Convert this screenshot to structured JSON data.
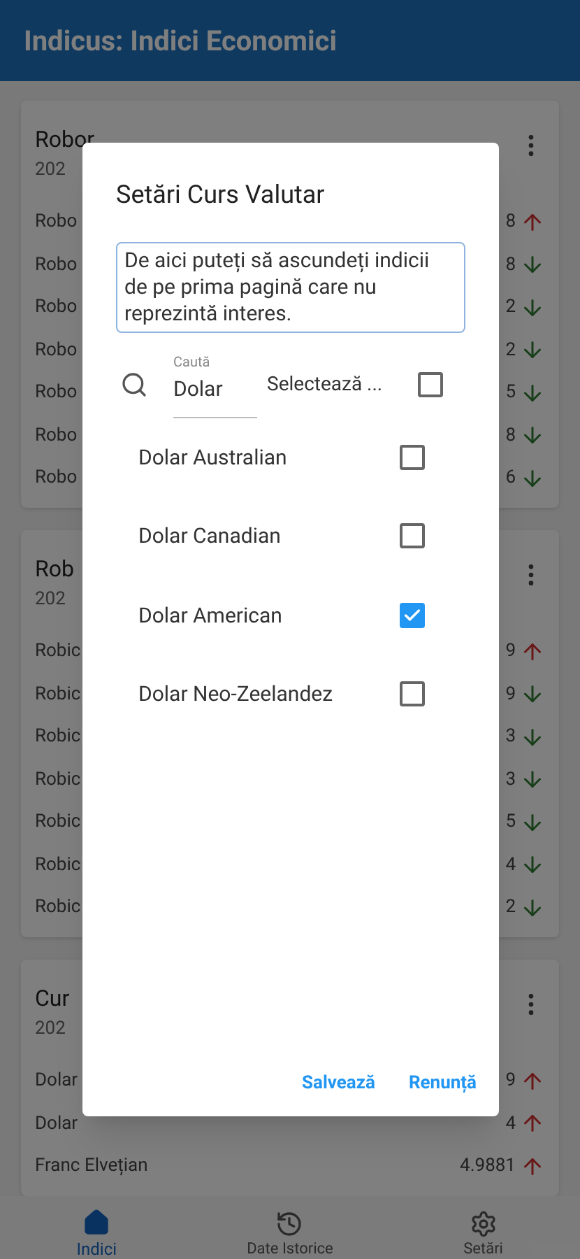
{
  "app_bar": {
    "title": "Indicus: Indici Economici"
  },
  "cards": [
    {
      "title": "Robor",
      "date": "202",
      "rows": [
        {
          "label": "Robo",
          "value": "8",
          "kind": "up"
        },
        {
          "label": "Robo",
          "value": "8",
          "kind": "down"
        },
        {
          "label": "Robo",
          "value": "2",
          "kind": "down"
        },
        {
          "label": "Robo",
          "value": "2",
          "kind": "down"
        },
        {
          "label": "Robo",
          "value": "5",
          "kind": "down"
        },
        {
          "label": "Robo",
          "value": "8",
          "kind": "down"
        },
        {
          "label": "Robo",
          "value": "6",
          "kind": "down"
        }
      ]
    },
    {
      "title": "Rob",
      "date": "202",
      "rows": [
        {
          "label": "Robic",
          "value": "9",
          "kind": "up"
        },
        {
          "label": "Robic",
          "value": "9",
          "kind": "down"
        },
        {
          "label": "Robic",
          "value": "3",
          "kind": "down"
        },
        {
          "label": "Robic",
          "value": "3",
          "kind": "down"
        },
        {
          "label": "Robic",
          "value": "5",
          "kind": "down"
        },
        {
          "label": "Robic",
          "value": "4",
          "kind": "down"
        },
        {
          "label": "Robic",
          "value": "2",
          "kind": "down"
        }
      ]
    },
    {
      "title": "Cur",
      "date": "202",
      "rows": [
        {
          "label": "Dolar",
          "value": "9",
          "kind": "up"
        },
        {
          "label": "Dolar",
          "value": "4",
          "kind": "up"
        },
        {
          "label": "Franc Elvețian",
          "value": "4.9881",
          "kind": "up"
        }
      ]
    }
  ],
  "dialog": {
    "title": "Setări Curs Valutar",
    "description": "De aici puteți să ascundeți indicii de pe prima pagină care nu reprezintă interes.",
    "search": {
      "label": "Caută",
      "value": "Dolar"
    },
    "select_all": {
      "label": "Selectează ...",
      "checked": false
    },
    "items": [
      {
        "label": "Dolar Australian",
        "checked": false
      },
      {
        "label": "Dolar Canadian",
        "checked": false
      },
      {
        "label": "Dolar American",
        "checked": true
      },
      {
        "label": "Dolar Neo-Zeelandez",
        "checked": false
      }
    ],
    "buttons": [
      "Salvează",
      "Renunță"
    ]
  },
  "bottom_nav": [
    {
      "label": "Indici",
      "selected": true
    },
    {
      "label": "Date Istorice",
      "selected": false
    },
    {
      "label": "Setări",
      "selected": false
    }
  ]
}
